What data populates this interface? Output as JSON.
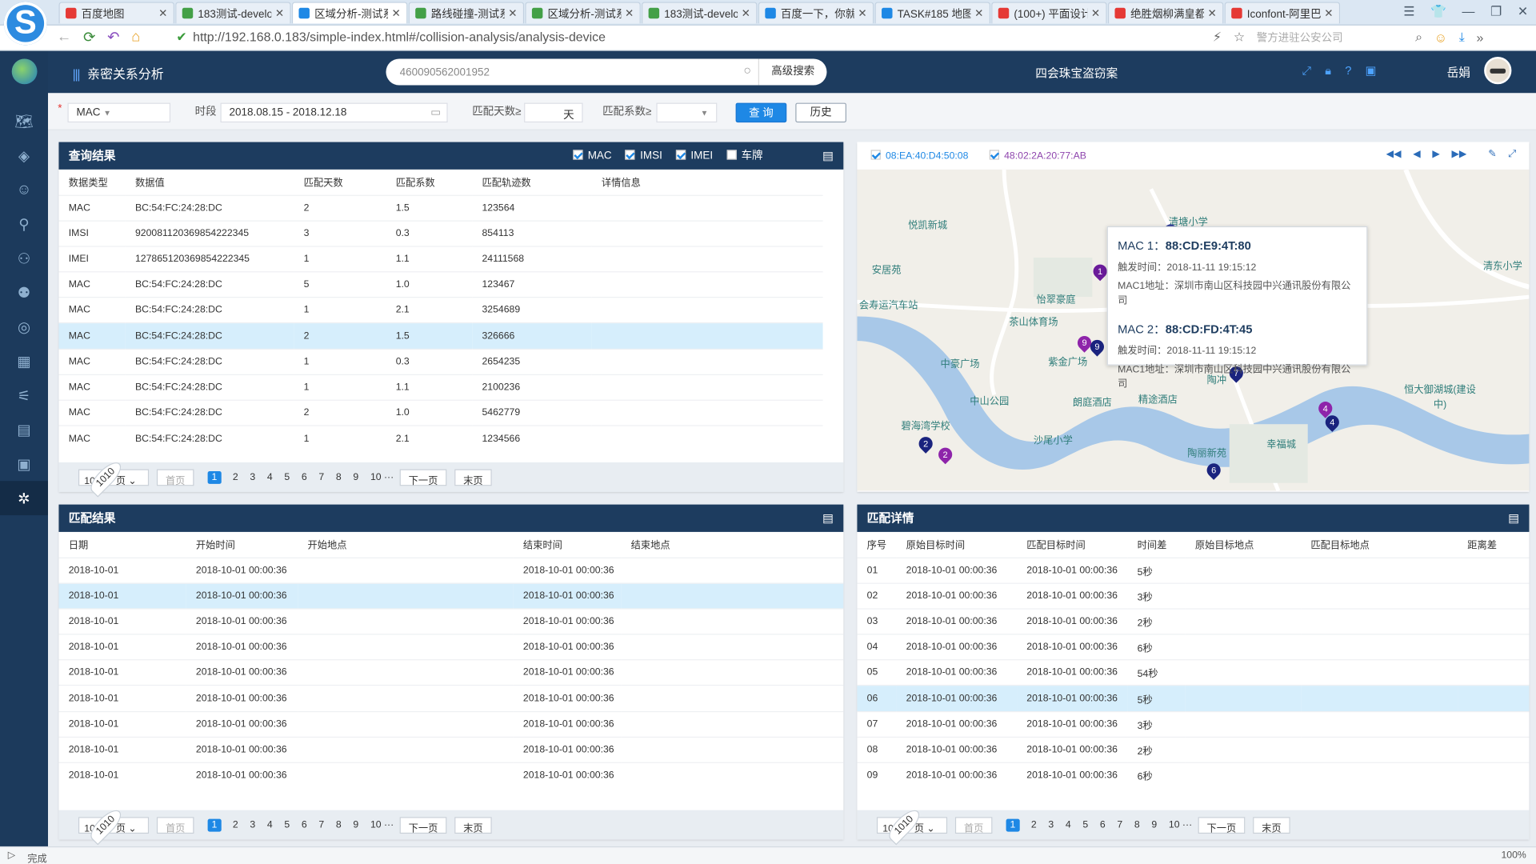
{
  "browser": {
    "tabs": [
      {
        "title": "百度地图",
        "color": "#e53935"
      },
      {
        "title": "183测试-develo",
        "color": "#43a047"
      },
      {
        "title": "区域分析-测试系",
        "color": "#1e88e5"
      },
      {
        "title": "路线碰撞-测试系",
        "color": "#43a047"
      },
      {
        "title": "区域分析-测试系",
        "color": "#43a047"
      },
      {
        "title": "183测试-develo",
        "color": "#43a047"
      },
      {
        "title": "百度一下，你就",
        "color": "#1e88e5"
      },
      {
        "title": "TASK#185 地图",
        "color": "#1e88e5"
      },
      {
        "title": "(100+) 平面设计",
        "color": "#e53935"
      },
      {
        "title": "绝胜烟柳满皇都",
        "color": "#e53935"
      },
      {
        "title": "Iconfont-阿里巴",
        "color": "#e53935"
      }
    ],
    "active_tab": 2,
    "url": "http://192.168.0.183/simple-index.html#/collision-analysis/analysis-device",
    "addr_hint": "警方进驻公安公司",
    "status": "完成",
    "zoom": "100%"
  },
  "sidebar": {
    "icons": [
      "map-icon",
      "cluster-icon",
      "person-icon",
      "antenna-icon",
      "person-search-icon",
      "person-link-icon",
      "search-doc-icon",
      "chart-icon",
      "route-icon",
      "report-icon",
      "device-icon",
      "relation-icon"
    ],
    "active_index": 11
  },
  "header": {
    "title": "亲密关系分析",
    "search_value": "460090562001952",
    "adv_search": "高级搜索",
    "case_name": "四会珠宝盗窃案",
    "user": "岳娟"
  },
  "filter": {
    "type_value": "MAC",
    "period_label": "时段",
    "period_value": "2018.08.15 - 2018.12.18",
    "days_label": "匹配天数≥",
    "days_unit": "天",
    "coef_label": "匹配系数≥",
    "query_btn": "查 询",
    "history_btn": "历史"
  },
  "query_results": {
    "title": "查询结果",
    "checks": [
      {
        "label": "MAC",
        "on": true
      },
      {
        "label": "IMSI",
        "on": true
      },
      {
        "label": "IMEI",
        "on": true
      },
      {
        "label": "车牌",
        "on": false
      }
    ],
    "columns": [
      "数据类型",
      "数据值",
      "匹配天数",
      "匹配系数",
      "匹配轨迹数",
      "详情信息"
    ],
    "rows": [
      [
        "MAC",
        "BC:54:FC:24:28:DC",
        "2",
        "1.5",
        "123564",
        ""
      ],
      [
        "IMSI",
        "920081120369854222345",
        "3",
        "0.3",
        "854113",
        ""
      ],
      [
        "IMEI",
        "127865120369854222345",
        "1",
        "1.1",
        "24111568",
        ""
      ],
      [
        "MAC",
        "BC:54:FC:24:28:DC",
        "5",
        "1.0",
        "123467",
        ""
      ],
      [
        "MAC",
        "BC:54:FC:24:28:DC",
        "1",
        "2.1",
        "3254689",
        ""
      ],
      [
        "MAC",
        "BC:54:FC:24:28:DC",
        "2",
        "1.5",
        "326666",
        ""
      ],
      [
        "MAC",
        "BC:54:FC:24:28:DC",
        "1",
        "0.3",
        "2654235",
        ""
      ],
      [
        "MAC",
        "BC:54:FC:24:28:DC",
        "1",
        "1.1",
        "2100236",
        ""
      ],
      [
        "MAC",
        "BC:54:FC:24:28:DC",
        "2",
        "1.0",
        "5462779",
        ""
      ],
      [
        "MAC",
        "BC:54:FC:24:28:DC",
        "1",
        "2.1",
        "1234566",
        ""
      ]
    ],
    "highlight_row": 5
  },
  "pager": {
    "size": "10 条 / 页",
    "first": "首页",
    "pages": [
      "1",
      "2",
      "3",
      "4",
      "5",
      "6",
      "7",
      "8",
      "9",
      "10 ···"
    ],
    "current": 0,
    "total": "1010",
    "next": "下一页",
    "last": "末页"
  },
  "map": {
    "mac_a": "08:EA:40:D4:50:08",
    "mac_b": "48:02:2A:20:77:AB",
    "labels": [
      "悦凯新城",
      "清塘小学",
      "安居苑",
      "会寿运汽车站",
      "怡翠豪庭",
      "茶山体育场",
      "中豪广场",
      "紫金广场",
      "中山公园",
      "朗庭酒店",
      "精途酒店",
      "碧海湾学校",
      "沙尾小学",
      "陶冲",
      "幸福城",
      "陶丽新苑",
      "清东小学",
      "恒大御湖城(建设中)"
    ],
    "popup": {
      "mac1_label": "MAC 1：",
      "mac1_value": "88:CD:E9:4T:80",
      "mac1_time": "触发时间：2018-11-11 19:15:12",
      "mac1_addr": "MAC1地址：深圳市南山区科技园中兴通讯股份有限公司",
      "mac2_label": "MAC 2：",
      "mac2_value": "88:CD:FD:4T:45",
      "mac2_time": "触发时间：2018-11-11 19:15:12",
      "mac2_addr": "MAC1地址：深圳市南山区科技园中兴通讯股份有限公司"
    },
    "pins": [
      "1",
      "2",
      "9",
      "9",
      "7",
      "4",
      "4",
      "2",
      "2",
      "6"
    ]
  },
  "match_results": {
    "title": "匹配结果",
    "columns": [
      "日期",
      "开始时间",
      "开始地点",
      "结束时间",
      "结束地点"
    ],
    "rows": [
      [
        "2018-10-01",
        "2018-10-01 00:00:36",
        "",
        "2018-10-01 00:00:36",
        ""
      ],
      [
        "2018-10-01",
        "2018-10-01 00:00:36",
        "",
        "2018-10-01 00:00:36",
        ""
      ],
      [
        "2018-10-01",
        "2018-10-01 00:00:36",
        "",
        "2018-10-01 00:00:36",
        ""
      ],
      [
        "2018-10-01",
        "2018-10-01 00:00:36",
        "",
        "2018-10-01 00:00:36",
        ""
      ],
      [
        "2018-10-01",
        "2018-10-01 00:00:36",
        "",
        "2018-10-01 00:00:36",
        ""
      ],
      [
        "2018-10-01",
        "2018-10-01 00:00:36",
        "",
        "2018-10-01 00:00:36",
        ""
      ],
      [
        "2018-10-01",
        "2018-10-01 00:00:36",
        "",
        "2018-10-01 00:00:36",
        ""
      ],
      [
        "2018-10-01",
        "2018-10-01 00:00:36",
        "",
        "2018-10-01 00:00:36",
        ""
      ],
      [
        "2018-10-01",
        "2018-10-01 00:00:36",
        "",
        "2018-10-01 00:00:36",
        ""
      ]
    ],
    "highlight_row": 1
  },
  "match_detail": {
    "title": "匹配详情",
    "columns": [
      "序号",
      "原始目标时间",
      "匹配目标时间",
      "时间差",
      "原始目标地点",
      "匹配目标地点",
      "距离差"
    ],
    "rows": [
      [
        "01",
        "2018-10-01 00:00:36",
        "2018-10-01 00:00:36",
        "5秒",
        "",
        "",
        ""
      ],
      [
        "02",
        "2018-10-01 00:00:36",
        "2018-10-01 00:00:36",
        "3秒",
        "",
        "",
        ""
      ],
      [
        "03",
        "2018-10-01 00:00:36",
        "2018-10-01 00:00:36",
        "2秒",
        "",
        "",
        ""
      ],
      [
        "04",
        "2018-10-01 00:00:36",
        "2018-10-01 00:00:36",
        "6秒",
        "",
        "",
        ""
      ],
      [
        "05",
        "2018-10-01 00:00:36",
        "2018-10-01 00:00:36",
        "54秒",
        "",
        "",
        ""
      ],
      [
        "06",
        "2018-10-01 00:00:36",
        "2018-10-01 00:00:36",
        "5秒",
        "",
        "",
        ""
      ],
      [
        "07",
        "2018-10-01 00:00:36",
        "2018-10-01 00:00:36",
        "3秒",
        "",
        "",
        ""
      ],
      [
        "08",
        "2018-10-01 00:00:36",
        "2018-10-01 00:00:36",
        "2秒",
        "",
        "",
        ""
      ],
      [
        "09",
        "2018-10-01 00:00:36",
        "2018-10-01 00:00:36",
        "6秒",
        "",
        "",
        ""
      ]
    ],
    "highlight_row": 5
  }
}
